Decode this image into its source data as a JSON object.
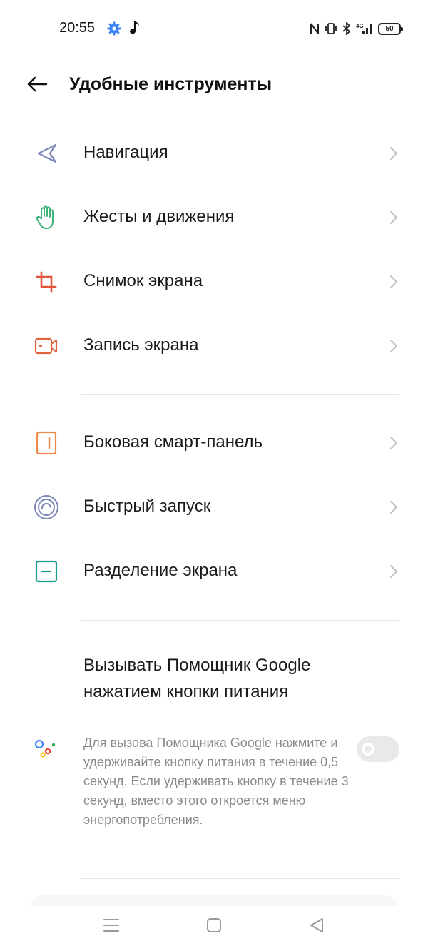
{
  "status_bar": {
    "time": "20:55",
    "network": "4G",
    "battery": "50"
  },
  "header": {
    "back_icon": "arrow-left-icon",
    "title": "Удобные инструменты"
  },
  "menu": {
    "items": [
      {
        "label": "Навигация",
        "icon": "navigation-icon",
        "color": "#7b86b9"
      },
      {
        "label": "Жесты и движения",
        "icon": "hand-gesture-icon",
        "color": "#3db27a"
      },
      {
        "label": "Снимок экрана",
        "icon": "crop-screenshot-icon",
        "color": "#e5533a"
      },
      {
        "label": "Запись экрана",
        "icon": "screen-record-icon",
        "color": "#e0623e"
      },
      {
        "label": "Боковая смарт-панель",
        "icon": "side-panel-icon",
        "color": "#f08a4b"
      },
      {
        "label": "Быстрый запуск",
        "icon": "quick-launch-icon",
        "color": "#7b86b9"
      },
      {
        "label": "Разделение экрана",
        "icon": "split-screen-icon",
        "color": "#1e9c8c"
      }
    ]
  },
  "assistant": {
    "title": "Вызывать Помощник Google нажатием кнопки питания",
    "description": "Для вызова Помощника Google нажмите и удерживайте кнопку питания в течение 0,5 секунд. Если удерживать кнопку в течение 3 секунд, вместо этого откроется меню энергопотребления.",
    "icon": "google-assistant-icon",
    "toggle_on": false
  },
  "nav": {
    "menu_icon": "menu-lines-icon",
    "home_icon": "home-square-icon",
    "back_icon": "back-triangle-icon"
  }
}
